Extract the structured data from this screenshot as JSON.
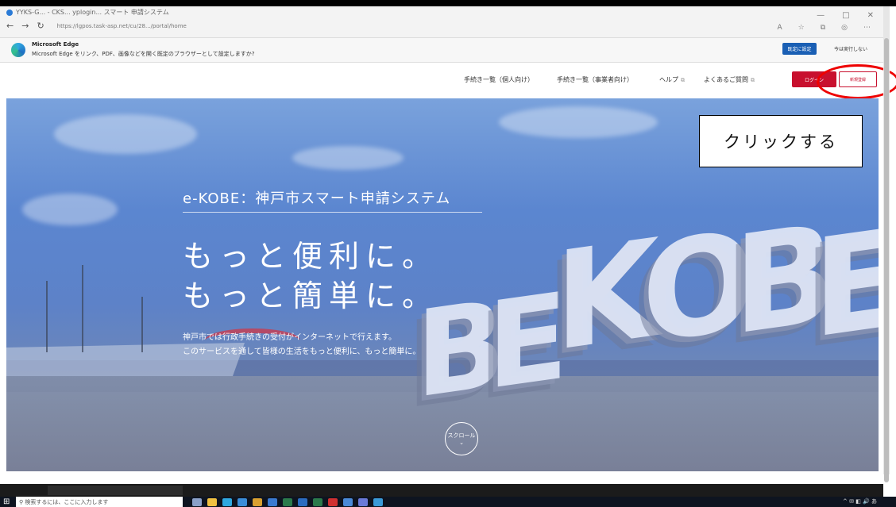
{
  "browser": {
    "tab_title": "YYKS-G... - CKS... yplogin... スマート 申請システム",
    "address": "https://lgpos.task-asp.net/cu/28.../portal/home",
    "window_controls": [
      "—",
      "□",
      "✕"
    ]
  },
  "infobar": {
    "title": "Microsoft Edge",
    "message": "Microsoft Edge をリンク、PDF、画像などを開く既定のブラウザーとして設定しますか?",
    "set_default_label": "既定に設定",
    "not_now_label": "今は実行しない"
  },
  "site_header": {
    "nav": [
      {
        "label": "手続き一覧（個人向け）"
      },
      {
        "label": "手続き一覧（事業者向け）"
      },
      {
        "label": "ヘルプ"
      },
      {
        "label": "よくあるご質問"
      }
    ],
    "login_label": "ログイン",
    "register_label": "新規登録"
  },
  "hero": {
    "title": "e-KOBE：神戸市スマート申請システム",
    "tagline_1": "もっと便利に。",
    "tagline_2": "もっと簡単に。",
    "sub_1": "神戸市では行政手続きの受付がインターネットで行えます。",
    "sub_2": "このサービスを通して皆様の生活をもっと便利に、もっと簡単に。",
    "sign_text": "BE KOBE",
    "scroll_label": "スクロール"
  },
  "annotation": {
    "callout": "クリックする"
  },
  "taskbar": {
    "search_placeholder": "検索するには、ここに入力します"
  }
}
